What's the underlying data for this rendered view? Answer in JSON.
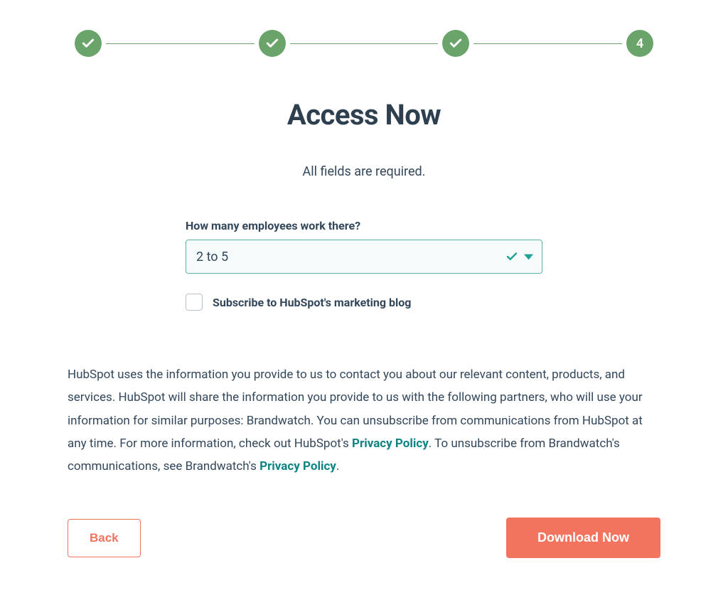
{
  "progress": {
    "steps": [
      {
        "state": "complete"
      },
      {
        "state": "complete"
      },
      {
        "state": "complete"
      },
      {
        "state": "current",
        "label": "4"
      }
    ]
  },
  "heading": "Access Now",
  "subheading": "All fields are required.",
  "form": {
    "employees": {
      "label": "How many employees work there?",
      "value": "2 to 5"
    },
    "subscribe": {
      "label": "Subscribe to HubSpot's marketing blog",
      "checked": false
    }
  },
  "legal": {
    "part1": "HubSpot uses the information you provide to us to contact you about our relevant content, products, and services. HubSpot will share the information you provide to us with the following partners, who will use your information for similar purposes: Brandwatch. You can unsubscribe from communications from HubSpot at any time. For more information, check out HubSpot's ",
    "link1": "Privacy Policy",
    "part2": ". To unsubscribe from Brandwatch's communications, see Brandwatch's ",
    "link2": "Privacy Policy",
    "part3": "."
  },
  "buttons": {
    "back": "Back",
    "download": "Download Now"
  }
}
